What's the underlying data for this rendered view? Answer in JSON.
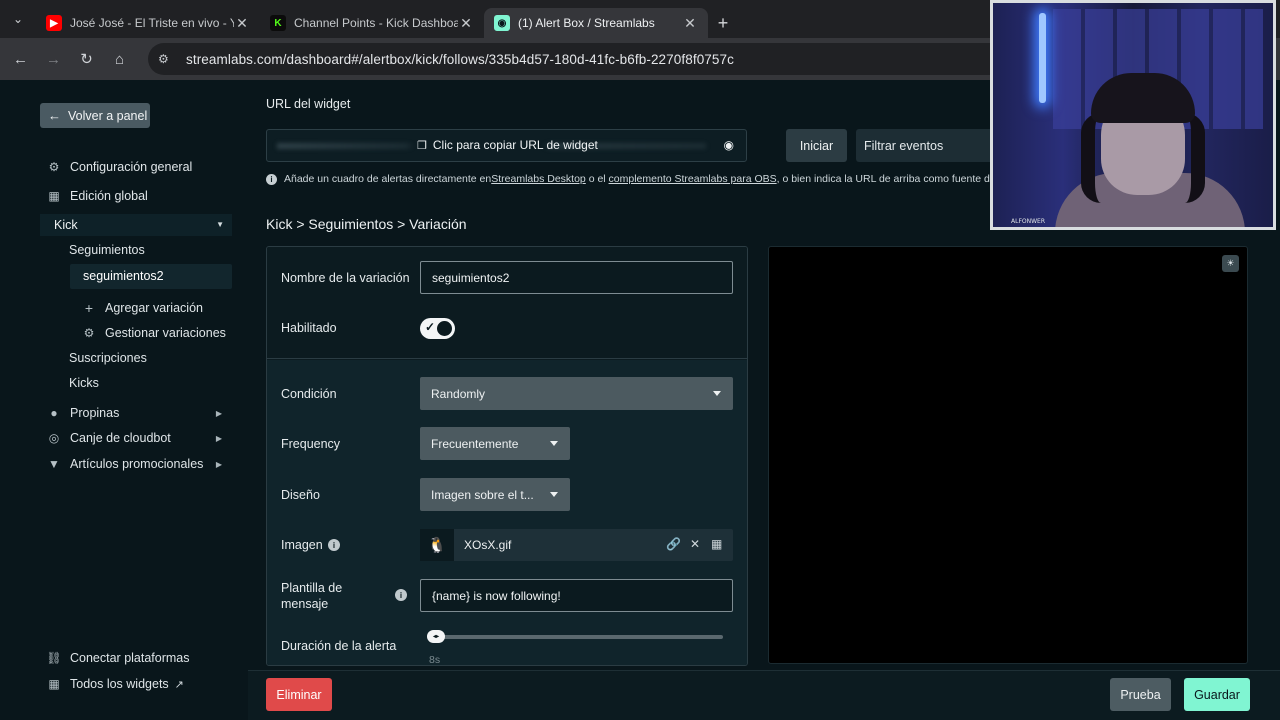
{
  "browser": {
    "tabs": [
      {
        "title": "José José - El Triste en vivo - YouTube",
        "favicon": "youtube-icon",
        "color": "#ff0000",
        "active": false
      },
      {
        "title": "Channel Points - Kick Dashboard",
        "favicon": "kick-icon",
        "color": "#53fc18",
        "active": false
      },
      {
        "title": "(1) Alert Box / Streamlabs",
        "favicon": "streamlabs-icon",
        "color": "#80f5d2",
        "active": true
      }
    ],
    "url": "streamlabs.com/dashboard#/alertbox/kick/follows/335b4d57-180d-41fc-b6fb-2270f8f0757c"
  },
  "sidebar": {
    "back_label": "Volver a panel",
    "items": [
      {
        "label": "Configuración general",
        "icon": "gear-icon"
      },
      {
        "label": "Edición global",
        "icon": "grid-icon"
      }
    ],
    "platform": "Kick",
    "platform_children": {
      "follows": "Seguimientos",
      "active_variation": "seguimientos2",
      "add_variation": "Agregar variación",
      "manage_variations": "Gestionar variaciones",
      "subscriptions": "Suscripciones",
      "kicks": "Kicks"
    },
    "groups": [
      {
        "label": "Propinas",
        "icon": "tips-icon"
      },
      {
        "label": "Canje de cloudbot",
        "icon": "cloudbot-icon"
      },
      {
        "label": "Artículos promocionales",
        "icon": "shirt-icon"
      }
    ],
    "bottom": {
      "connect": "Conectar plataformas",
      "all_widgets": "Todos los widgets"
    }
  },
  "main": {
    "widget_url_label": "URL del widget",
    "copy_label": "Clic para copiar URL de widget",
    "start_label": "Iniciar",
    "filter_placeholder": "Filtrar eventos",
    "info": {
      "prefix": "Añade un cuadro de alertas directamente en ",
      "link1": "Streamlabs Desktop",
      "middle": " o el ",
      "link2": "complemento Streamlabs para OBS",
      "suffix": ", o bien indica la URL de arriba como fuente d"
    },
    "breadcrumb": "Kick > Seguimientos > Variación",
    "form": {
      "variation_name_label": "Nombre de la variación",
      "variation_name_value": "seguimientos2",
      "enabled_label": "Habilitado",
      "enabled": true,
      "condition_label": "Condición",
      "condition_value": "Randomly",
      "frequency_label": "Frequency",
      "frequency_value": "Frecuentemente",
      "design_label": "Diseño",
      "design_value": "Imagen sobre el t...",
      "image_label": "Imagen",
      "image_name": "XOsX.gif",
      "message_label": "Plantilla de mensaje",
      "message_value": "{name} is now following!",
      "duration_label": "Duración de la alerta",
      "duration_value": "8s",
      "duration_fraction": 0.0
    }
  },
  "footer": {
    "delete": "Eliminar",
    "test": "Prueba",
    "save": "Guardar"
  },
  "webcam": {
    "overlay_text": "ALFONWER"
  },
  "colors": {
    "accent": "#80f5d2",
    "danger": "#e04a4a",
    "background": "#09161b"
  }
}
